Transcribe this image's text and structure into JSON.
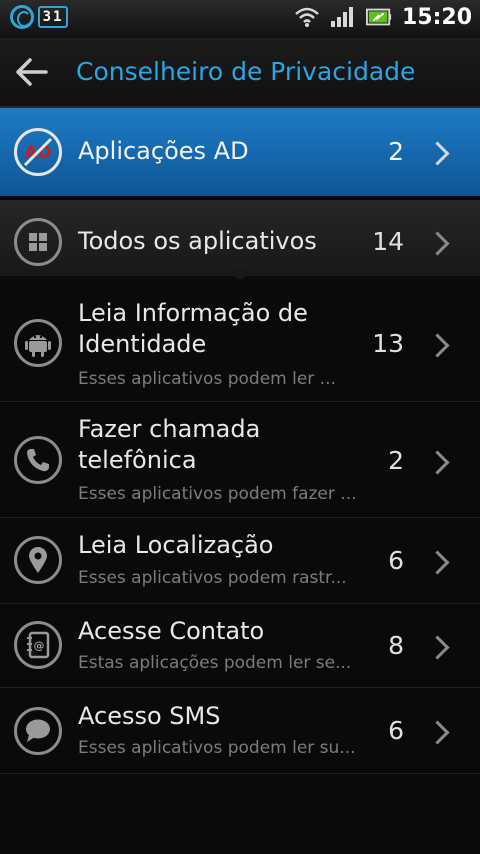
{
  "status_bar": {
    "calendar_day": "31",
    "time": "15:20",
    "icons": [
      "app-circle-icon",
      "calendar-icon",
      "wifi-icon",
      "signal-icon",
      "battery-icon"
    ]
  },
  "header": {
    "title": "Conselheiro de Privacidade",
    "back_icon": "back-arrow-icon"
  },
  "colors": {
    "accent": "#2aa6e8",
    "highlight_row": "#1468b0",
    "background": "#0a0a0a"
  },
  "list": {
    "ad": {
      "label": "Aplicações AD",
      "count": "2",
      "icon": "no-ad-icon"
    },
    "all": {
      "label": "Todos os aplicativos",
      "count": "14",
      "icon": "apps-grid-icon"
    },
    "items": [
      {
        "label_line1": "Leia Informação de",
        "label_line2": "Identidade",
        "subtitle": "Esses aplicativos podem ler ...",
        "count": "13",
        "icon": "android-icon"
      },
      {
        "label_line1": "Fazer chamada",
        "label_line2": "telefônica",
        "subtitle": "Esses aplicativos podem fazer ...",
        "count": "2",
        "icon": "phone-icon"
      },
      {
        "label_line1": "Leia Localização",
        "subtitle": "Esses aplicativos podem rastr...",
        "count": "6",
        "icon": "location-pin-icon"
      },
      {
        "label_line1": "Acesse Contato",
        "subtitle": "Estas aplicações podem ler se...",
        "count": "8",
        "icon": "contacts-book-icon"
      },
      {
        "label_line1": "Acesso SMS",
        "subtitle": "Esses aplicativos podem ler su...",
        "count": "6",
        "icon": "sms-bubble-icon"
      }
    ]
  }
}
